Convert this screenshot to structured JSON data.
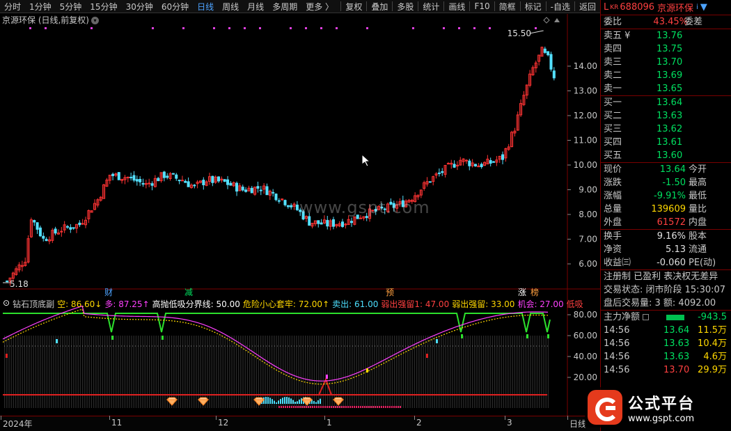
{
  "toolbar": {
    "periods": [
      "分时",
      "1分钟",
      "5分钟",
      "15分钟",
      "30分钟",
      "60分钟",
      "日线",
      "周线",
      "月线",
      "多周期",
      "更多 〉"
    ],
    "active_period": "日线",
    "tools": [
      "复权",
      "叠加",
      "多股",
      "统计",
      "画线",
      "F10",
      "简框",
      "标记",
      "-自选",
      "返回"
    ]
  },
  "chart": {
    "title": "京源环保 (日线,前复权)",
    "high_label": "15.50",
    "low_label": "5.18",
    "price_axis": [
      "14.00",
      "13.00",
      "12.00",
      "11.00",
      "10.00",
      "9.00",
      "8.00",
      "7.00",
      "6.00"
    ],
    "ind_axis": [
      "80.00",
      "60.00",
      "40.00",
      "20.00"
    ],
    "event_labels": [
      {
        "text": "财",
        "color": "#4da3ff"
      },
      {
        "text": "减",
        "color": "#00e060"
      },
      {
        "text": "预",
        "color": "#ffa040"
      },
      {
        "text": "涨",
        "color": "#ffffff"
      },
      {
        "text": "榜",
        "color": "#ffa040"
      }
    ],
    "date_labels": [
      "2024年",
      "11",
      "12",
      "1",
      "2",
      "3",
      "日线"
    ],
    "watermark": "www.gspt.com"
  },
  "indicator": {
    "name": "钻石顶底副",
    "items": [
      {
        "text": "空: 86.60↓",
        "color": "#ffd800"
      },
      {
        "text": "多: 87.25↑",
        "color": "#ff40ff"
      },
      {
        "text": "高抛低吸分界线: 50.00",
        "color": "#ffffff"
      },
      {
        "text": "危险小心套牢: 72.00↑",
        "color": "#ffd800"
      },
      {
        "text": "卖出: 61.00",
        "color": "#4de0ff"
      },
      {
        "text": "弱出强留1: 47.00",
        "color": "#ff4040"
      },
      {
        "text": "弱出强留: 33.00",
        "color": "#ffd800"
      },
      {
        "text": "机会: 27.00",
        "color": "#ff40ff"
      },
      {
        "text": "低吸",
        "color": "#ff4040"
      }
    ]
  },
  "quote": {
    "code": "688096",
    "name": "京源环保",
    "flag_l": "L",
    "flag_kr": "KR",
    "weibi": {
      "label": "委比",
      "value": "43.45%",
      "label2": "委差"
    },
    "asks": [
      {
        "label": "卖五 ¥",
        "price": "13.76"
      },
      {
        "label": "卖四",
        "price": "13.75"
      },
      {
        "label": "卖三",
        "price": "13.70"
      },
      {
        "label": "卖二",
        "price": "13.69"
      },
      {
        "label": "卖一",
        "price": "13.65"
      }
    ],
    "bids": [
      {
        "label": "买一",
        "price": "13.64"
      },
      {
        "label": "买二",
        "price": "13.63"
      },
      {
        "label": "买三",
        "price": "13.62"
      },
      {
        "label": "买四",
        "price": "13.61"
      },
      {
        "label": "买五",
        "price": "13.60"
      }
    ],
    "stats": [
      {
        "label": "现价",
        "value": "13.64",
        "label2": "今开",
        "color": "#00e060"
      },
      {
        "label": "涨跌",
        "value": "-1.50",
        "label2": "最高",
        "color": "#00e060"
      },
      {
        "label": "涨幅",
        "value": "-9.91%",
        "label2": "最低",
        "color": "#00e060"
      },
      {
        "label": "总量",
        "value": "139609",
        "label2": "量比",
        "color": "#ffd800"
      },
      {
        "label": "外盘",
        "value": "61572",
        "label2": "内盘",
        "color": "#ff4040"
      }
    ],
    "stats2": [
      {
        "label": "换手",
        "value": "9.16%",
        "label2": "股本",
        "color": "#e0e0e0"
      },
      {
        "label": "净资",
        "value": "5.13",
        "label2": "流通",
        "color": "#e0e0e0"
      },
      {
        "label": "收益㈢",
        "value": "-0.060",
        "label2": "PE(动)",
        "color": "#e0e0e0"
      }
    ],
    "notes": [
      "注册制 已盈利 表决权无差异",
      "交易状态: 闭市阶段 15:30:07",
      "盘后交易量: 3 额: 4092.00"
    ],
    "main_flow": {
      "label": "主力净额",
      "value": "-943.5"
    },
    "ticks": [
      {
        "time": "14:56",
        "price": "13.64",
        "vol": "11.5万"
      },
      {
        "time": "14:56",
        "price": "13.63",
        "vol": "10.4万"
      },
      {
        "time": "14:56",
        "price": "13.63",
        "vol": "4.6万"
      },
      {
        "time": "14:56",
        "price": "13.70",
        "vol": "29.9万"
      }
    ]
  },
  "logo": {
    "title": "公式平台",
    "url": "www.gspt.com"
  },
  "colors": {
    "up": "#ff3333",
    "down": "#54e0ff",
    "green": "#00e060",
    "background": "#000000"
  }
}
